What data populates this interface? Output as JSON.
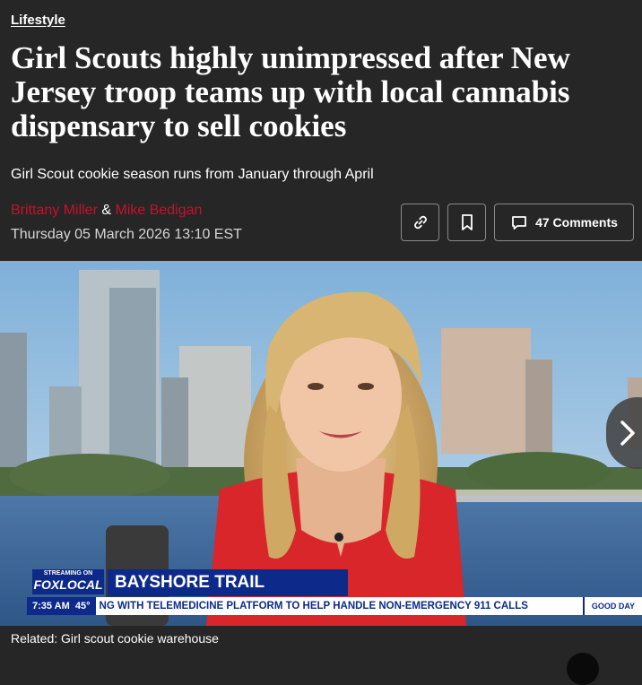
{
  "article": {
    "category": "Lifestyle",
    "headline": "Girl Scouts highly unimpressed after New Jersey troop teams up with local cannabis dispensary to sell cookies",
    "subhead": "Girl Scout cookie season runs from January through April",
    "authors": [
      "Brittany Miller",
      "Mike Bedigan"
    ],
    "author_separator": "&",
    "date": "Thursday 05 March 2026 13:10 EST"
  },
  "actions": {
    "comments_label": "47 Comments"
  },
  "video": {
    "streaming_label": "STREAMING ON",
    "network_label": "FOXLOCAL",
    "show_title": "BAYSHORE TRAIL",
    "time": "7:35 AM",
    "temperature": "45°",
    "ticker_text": "NG WITH TELEMEDICINE PLATFORM TO HELP HANDLE NON-EMERGENCY 911 CALLS",
    "program_tag": "GOOD DAY"
  },
  "related": {
    "text": "Related: Girl scout cookie warehouse"
  },
  "colors": {
    "background": "#262626",
    "author_link": "#c8102e",
    "lower_third_blue": "#0d2a8a"
  },
  "icons": [
    "link-icon",
    "bookmark-icon",
    "comment-icon",
    "chevron-right-icon"
  ]
}
